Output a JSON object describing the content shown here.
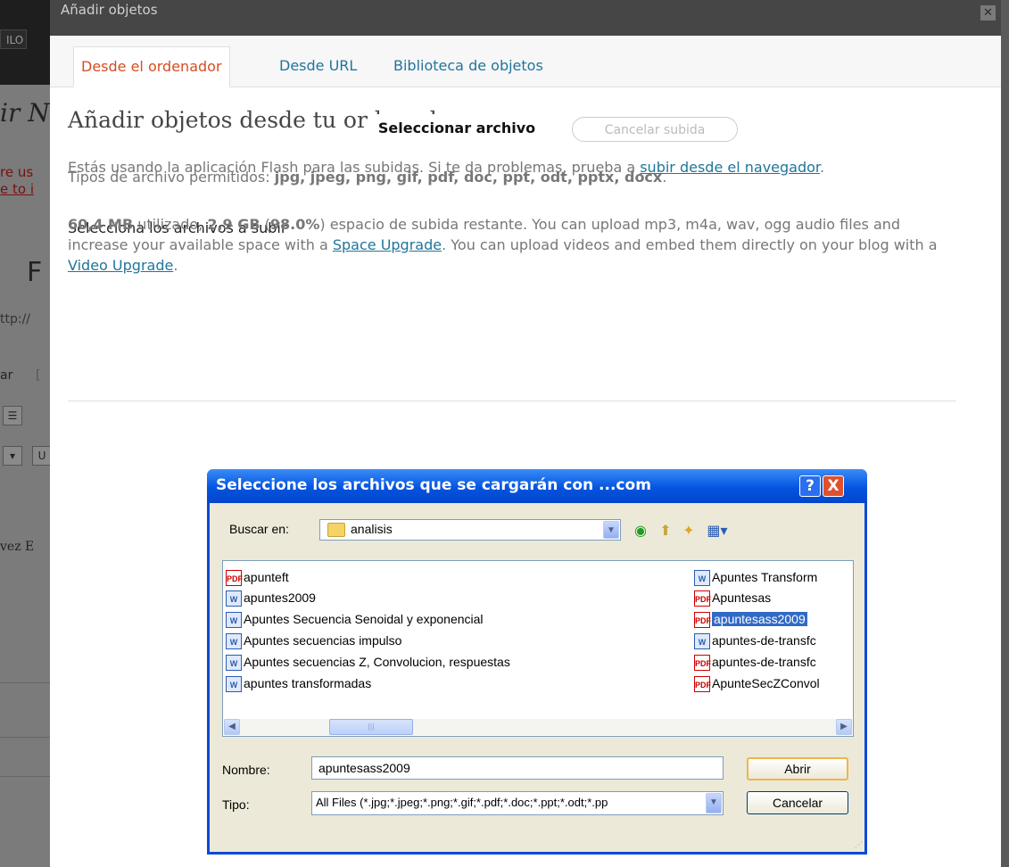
{
  "background_page": {
    "btn_fragment": "ILO",
    "title_fragment": "ir N",
    "notice_line1": "re us",
    "notice_line2": "e to i",
    "big_letter": "F",
    "url_fragment": "ttp://",
    "field_fragment": "ar",
    "bracket": "[",
    "text_fragment": "vez E"
  },
  "modal": {
    "title": "Añadir objetos",
    "close_icon": "close-icon",
    "tabs": [
      {
        "label": "Desde el ordenador",
        "active": true
      },
      {
        "label": "Desde URL",
        "active": false
      },
      {
        "label": "Biblioteca de objetos",
        "active": false
      }
    ],
    "heading": "Añadir objetos desde tu ordenador",
    "allowed_types_prefix": "Tipos de archivo permitidos: ",
    "allowed_types": "jpg, jpeg, png, gif, pdf, doc, ppt, odt, pptx, docx",
    "allowed_types_suffix": ".",
    "select_label": "Selecciona los archivos a subir",
    "select_button": "Seleccionar archivo",
    "cancel_upload": "Cancelar subida",
    "flash_notice": "Estás usando la aplicación Flash para las subidas. Si te da problemas, prueba a ",
    "flash_link": "subir desde el navegador",
    "flash_end": ".",
    "usage_used": "60,4 MB",
    "usage_text1": " utilizado, ",
    "usage_free": "2,9 GB",
    "usage_text2": " (",
    "usage_pct": "98.0%",
    "usage_text3": ") espacio de subida restante. You can upload mp3, m4a, wav, ogg audio files and increase your available space with a ",
    "space_link": "Space Upgrade",
    "usage_text4": ". You can upload videos and embed them directly on your blog with a ",
    "video_link": "Video Upgrade",
    "usage_text5": "."
  },
  "dialog": {
    "title": "Seleccione los archivos que se cargarán con ...com",
    "help_icon": "?",
    "close_icon": "X",
    "look_in_label": "Buscar en:",
    "look_in_value": "analisis",
    "files_left": [
      {
        "name": "apunteft",
        "type": "pdf"
      },
      {
        "name": "apuntes2009",
        "type": "doc"
      },
      {
        "name": "Apuntes Secuencia  Senoidal y exponencial",
        "type": "doc"
      },
      {
        "name": "Apuntes secuencias impulso",
        "type": "doc"
      },
      {
        "name": "Apuntes secuencias Z, Convolucion, respuestas",
        "type": "doc"
      },
      {
        "name": "apuntes transformadas",
        "type": "doc"
      }
    ],
    "files_right": [
      {
        "name": "Apuntes Transform",
        "type": "doc"
      },
      {
        "name": "Apuntesas",
        "type": "pdf"
      },
      {
        "name": "apuntesass2009",
        "type": "pdf",
        "selected": true
      },
      {
        "name": "apuntes-de-transfc",
        "type": "doc"
      },
      {
        "name": "apuntes-de-transfc",
        "type": "pdf"
      },
      {
        "name": "ApunteSecZConvol",
        "type": "pdf"
      }
    ],
    "name_label": "Nombre:",
    "name_value": "apuntesass2009",
    "type_label": "Tipo:",
    "type_value": "All Files (*.jpg;*.jpeg;*.png;*.gif;*.pdf;*.doc;*.ppt;*.odt;*.pp",
    "open_button": "Abrir",
    "cancel_button": "Cancelar"
  }
}
